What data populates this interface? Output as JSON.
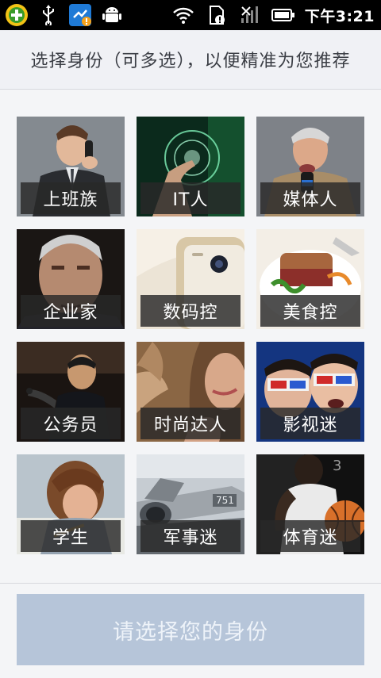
{
  "status_bar": {
    "time": "下午3:21",
    "colors": {
      "background": "#000000"
    }
  },
  "header": {
    "title": "选择身份（可多选），以便精准为您推荐"
  },
  "categories": [
    {
      "label": "上班族",
      "image": "businessman-on-phone"
    },
    {
      "label": "IT人",
      "image": "touchscreen-hand"
    },
    {
      "label": "媒体人",
      "image": "reporter-with-microphone"
    },
    {
      "label": "企业家",
      "image": "senior-man-portrait"
    },
    {
      "label": "数码控",
      "image": "smartphone-closeup"
    },
    {
      "label": "美食控",
      "image": "steak-dish"
    },
    {
      "label": "公务员",
      "image": "official-at-meeting"
    },
    {
      "label": "时尚达人",
      "image": "fashion-fur"
    },
    {
      "label": "影视迷",
      "image": "3d-glasses-couple"
    },
    {
      "label": "学生",
      "image": "child-writing"
    },
    {
      "label": "军事迷",
      "image": "fighter-jet"
    },
    {
      "label": "体育迷",
      "image": "basketball-player"
    }
  ],
  "footer": {
    "submit_label": "请选择您的身份",
    "submit_color": "#b6c5d9"
  }
}
